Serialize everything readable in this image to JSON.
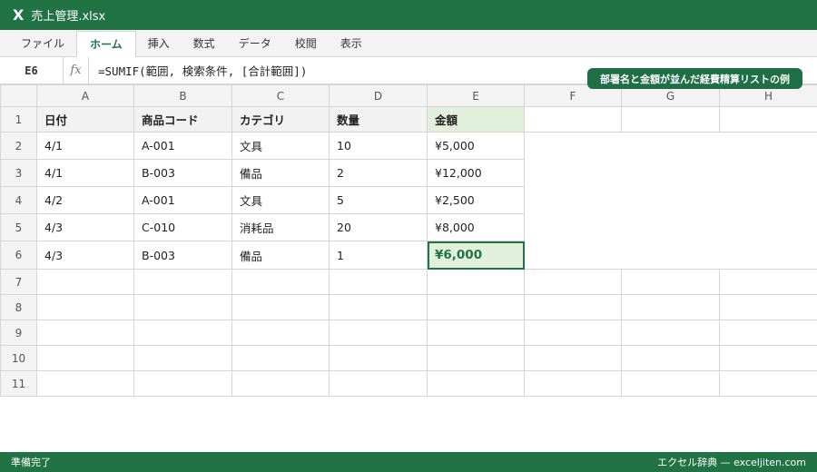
{
  "window": {
    "app_icon": "X",
    "title": "売上管理.xlsx"
  },
  "ribbon": {
    "tabs": [
      "ファイル",
      "ホーム",
      "挿入",
      "数式",
      "データ",
      "校閲",
      "表示"
    ],
    "active_tab": "ホーム"
  },
  "formula_bar": {
    "name_box": "E6",
    "fx_label": "fx",
    "formula": "=SUMIF(範囲, 検索条件, [合計範囲])"
  },
  "badge": {
    "text": "部署名と金額が並んだ経費精算リストの例"
  },
  "sheet": {
    "columns": [
      "A",
      "B",
      "C",
      "D",
      "E",
      "F",
      "G",
      "H"
    ],
    "header_row": {
      "num": "1",
      "cells": [
        "日付",
        "商品コード",
        "カテゴリ",
        "数量",
        "金額"
      ]
    },
    "rows": [
      {
        "num": "2",
        "cells": [
          "4/1",
          "A-001",
          "文具",
          "10",
          "¥5,000"
        ]
      },
      {
        "num": "3",
        "cells": [
          "4/1",
          "B-003",
          "備品",
          "2",
          "¥12,000"
        ]
      },
      {
        "num": "4",
        "cells": [
          "4/2",
          "A-001",
          "文具",
          "5",
          "¥2,500"
        ]
      },
      {
        "num": "5",
        "cells": [
          "4/3",
          "C-010",
          "消耗品",
          "20",
          "¥8,000"
        ]
      },
      {
        "num": "6",
        "cells": [
          "4/3",
          "B-003",
          "備品",
          "1",
          "¥6,000"
        ]
      }
    ],
    "empty_rows": [
      "7",
      "8",
      "9",
      "10",
      "11"
    ],
    "selected_cell": "E6"
  },
  "status": {
    "left": "準備完了",
    "right": "エクセル辞典 — exceljiten.com"
  },
  "colors": {
    "accent": "#217346",
    "selected_fill": "#e2efda",
    "badge": "#1e6e46"
  }
}
